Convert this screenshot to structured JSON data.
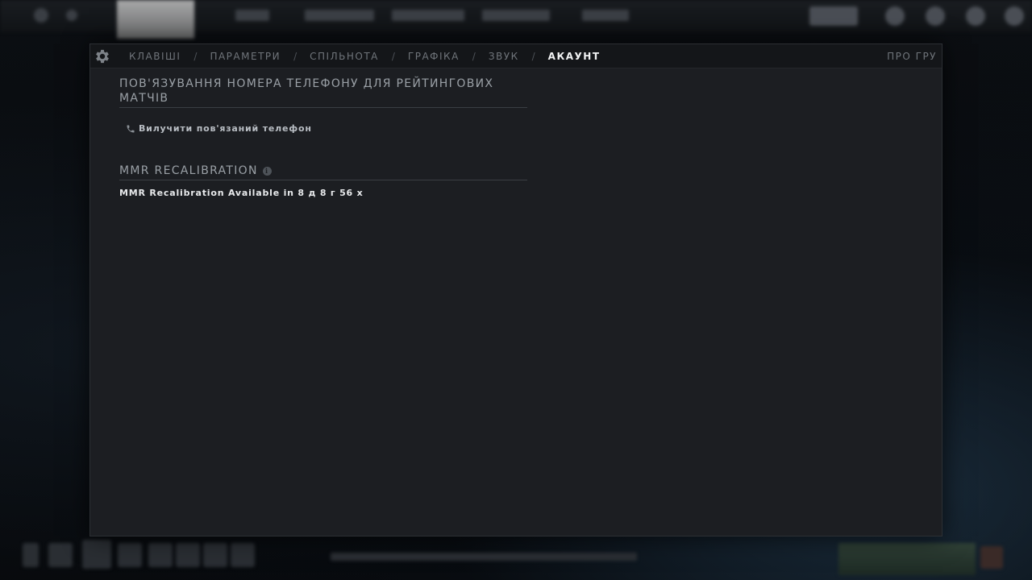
{
  "window": {
    "tabs": [
      {
        "label": "КЛАВІШІ"
      },
      {
        "label": "ПАРАМЕТРИ"
      },
      {
        "label": "СПІЛЬНОТА"
      },
      {
        "label": "ГРАФІКА"
      },
      {
        "label": "ЗВУК"
      },
      {
        "label": "АКАУНТ",
        "active": true
      }
    ],
    "separator": "/",
    "about_label": "ПРО ГРУ",
    "settings_icon": "gear-icon"
  },
  "phone_section": {
    "title": "ПОВ'ЯЗУВАННЯ НОМЕРА ТЕЛЕФОНУ ДЛЯ РЕЙТИНГОВИХ МАТЧІВ",
    "remove_phone_label": "Вилучити пов'язаний телефон",
    "icon": "phone-icon"
  },
  "mmr_section": {
    "title": "MMR RECALIBRATION",
    "info_icon": "info-icon",
    "status_text": "MMR Recalibration Available in 8 д 8 г 56 х"
  },
  "colors": {
    "panel_bg": "#1c1e22",
    "tab_bar_bg": "#141619",
    "active_tab": "#f2f3f4",
    "inactive_tab": "#70757b"
  }
}
